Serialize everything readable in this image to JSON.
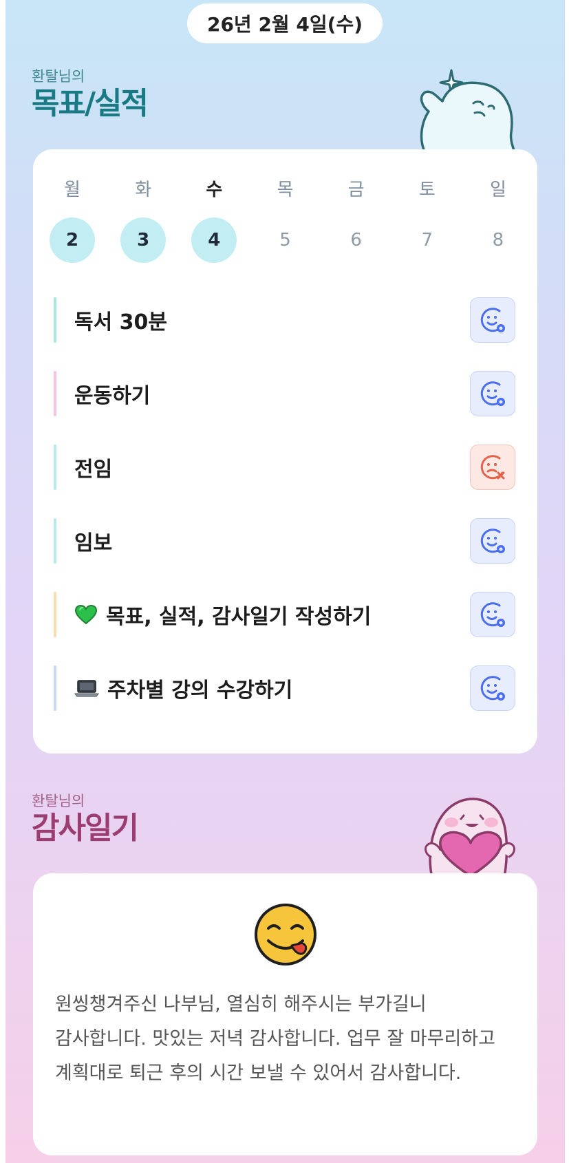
{
  "date_label": "26년 2월 4일(수)",
  "goals_section": {
    "subtitle": "환탈님의",
    "title": "목표/실적"
  },
  "week": {
    "days": [
      "월",
      "화",
      "수",
      "목",
      "금",
      "토",
      "일"
    ],
    "dates": [
      "2",
      "3",
      "4",
      "5",
      "6",
      "7",
      "8"
    ],
    "done_indices": [
      0,
      1,
      2
    ],
    "today_index": 2
  },
  "goals": [
    {
      "label": "독서 30분",
      "emoji": "",
      "status": "ok",
      "bar_color": "#a8e6e0"
    },
    {
      "label": "운동하기",
      "emoji": "",
      "status": "ok",
      "bar_color": "#f4c6e3"
    },
    {
      "label": "전임",
      "emoji": "",
      "status": "fail",
      "bar_color": "#b8e8f0"
    },
    {
      "label": "임보",
      "emoji": "",
      "status": "ok",
      "bar_color": "#b8e8f0"
    },
    {
      "label": "목표, 실적, 감사일기 작성하기",
      "emoji": "green-heart-icon",
      "status": "ok",
      "bar_color": "#f8ddb3"
    },
    {
      "label": "주차별 강의 수강하기",
      "emoji": "laptop-icon",
      "status": "ok",
      "bar_color": "#c8d8f5"
    }
  ],
  "diary_section": {
    "subtitle": "환탈님의",
    "title": "감사일기"
  },
  "diary": {
    "emoji": "yum-face-icon",
    "text": "원씽챙겨주신 나부님, 열심히 해주시는 부가길니 감사합니다. 맛있는 저녁 감사합니다. 업무 잘 마무리하고 계획대로 퇴근 후의 시간 보낼 수 있어서 감사합니다."
  },
  "colors": {
    "teal_title": "#197a84",
    "pink_title": "#9b3d72",
    "done_circle": "#c2eef3",
    "ok_icon": "#4a6ef0",
    "fail_icon": "#e2624a"
  }
}
